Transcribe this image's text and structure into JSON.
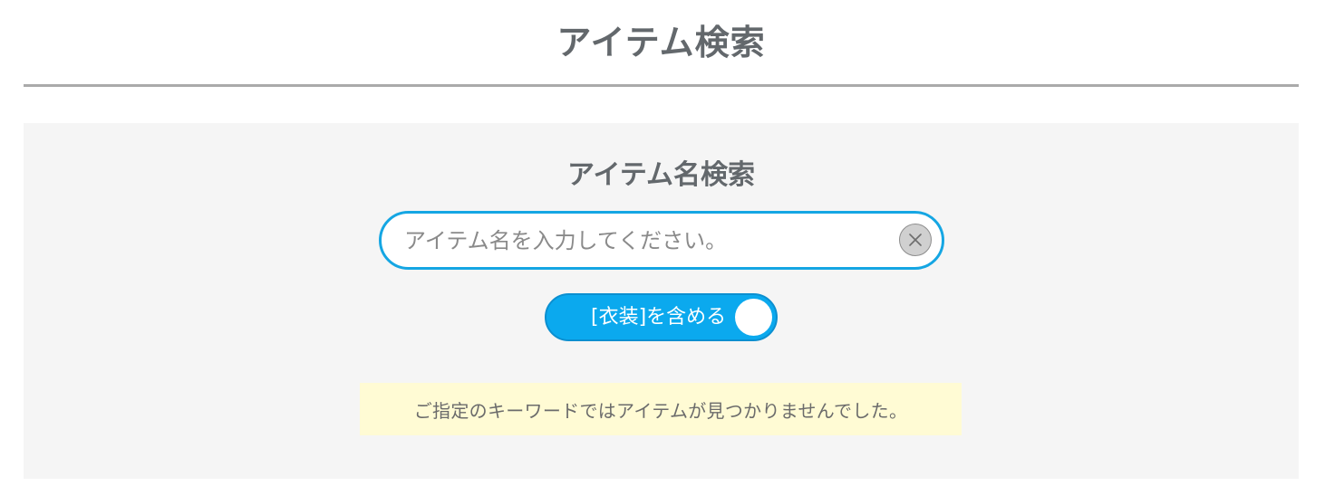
{
  "header": {
    "title": "アイテム検索"
  },
  "search": {
    "section_title": "アイテム名検索",
    "value": "",
    "placeholder": "アイテム名を入力してください。",
    "clear_icon": "close-icon"
  },
  "costume_toggle": {
    "label": "[衣装]を含める",
    "state": "on"
  },
  "result": {
    "message": "ご指定のキーワードではアイテムが見つかりませんでした。"
  },
  "colors": {
    "accent": "#15a6e3",
    "toggle_background": "#0ba9ee",
    "panel_background": "#f5f5f5",
    "message_background": "#fffbd4",
    "title_text": "#63686c"
  }
}
